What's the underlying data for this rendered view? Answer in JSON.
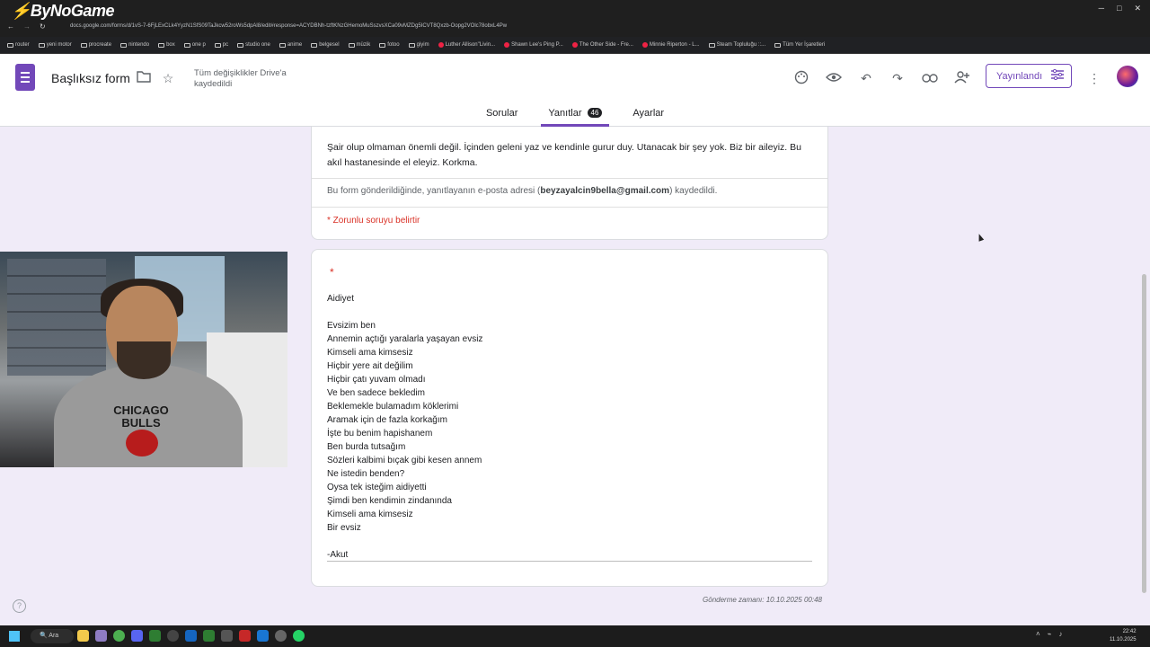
{
  "browser": {
    "overlay_logo": "ByNoGame",
    "url": "docs.google.com/forms/d/1vS-7-6FjLExCLk4YyzN1SfS09TaJkcw52roWs5dpAl8/edit#response=ACYDBNh-tzftKNzGHemoMuSszvsXCa09vMZDg5ICVT8Qxzb-Oopg2VOlc78obxL4Pw",
    "bookmarks": [
      "router",
      "yeni motor",
      "procreate",
      "nintendo",
      "box",
      "one p",
      "pc",
      "studio one",
      "anime",
      "belgesel",
      "müzik",
      "fotoo",
      "giyim",
      "Luther Allison\"Livin...",
      "Shawn Lee's Ping P...",
      "The Other Side - Fre...",
      "Minnie Riperton - L...",
      "Steam Topluluğu ::...",
      "Tüm Yer İşaretleri"
    ]
  },
  "header": {
    "title": "Başlıksız form",
    "save_status": "Tüm değişiklikler Drive'a kaydedildi",
    "publish_label": "Yayınlandı",
    "tabs": [
      {
        "label": "Sorular"
      },
      {
        "label": "Yanıtlar",
        "count": "46"
      },
      {
        "label": "Ayarlar"
      }
    ]
  },
  "form": {
    "description": "Şair olup olmaman önemli değil. İçinden geleni yaz ve kendinle gurur duy. Utanacak bir şey yok. Biz bir aileyiz. Bu akıl hastanesinde el eleyiz. Korkma.",
    "email_note_prefix": "Bu form gönderildiğinde, yanıtlayanın e-posta adresi (",
    "email": "beyzayalcin9bella@gmail.com",
    "email_note_suffix": ") kaydedildi.",
    "required_note": "* Zorunlu soruyu belirtir",
    "question_required_mark": "*",
    "answer": "Aidiyet\n\nEvsizim ben\nAnnemin açtığı yaralarla yaşayan evsiz\nKimseli ama kimsesiz\nHiçbir yere ait değilim\nHiçbir çatı yuvam olmadı\nVe ben sadece bekledim\nBeklemekle bulamadım köklerimi\nAramak için de fazla korkağım\nİşte bu benim hapishanem\nBen burda tutsağım\nSözleri kalbimi bıçak gibi kesen annem\nNe istedin benden?\nOysa tek isteğim aidiyetti\nŞimdi ben kendimin zindanında\nKimseli ama kimsesiz\nBir evsiz\n\n-Akut",
    "submit_time": "Gönderme zamanı: 10.10.2025 00:48"
  },
  "webcam": {
    "shirt_text": "CHICAGO\nBULLS"
  },
  "taskbar": {
    "search_label": "Ara",
    "time": "22:42",
    "date": "11.10.2025"
  },
  "colors": {
    "accent": "#7248b9",
    "required": "#d93025",
    "background": "#f0ebf8"
  }
}
